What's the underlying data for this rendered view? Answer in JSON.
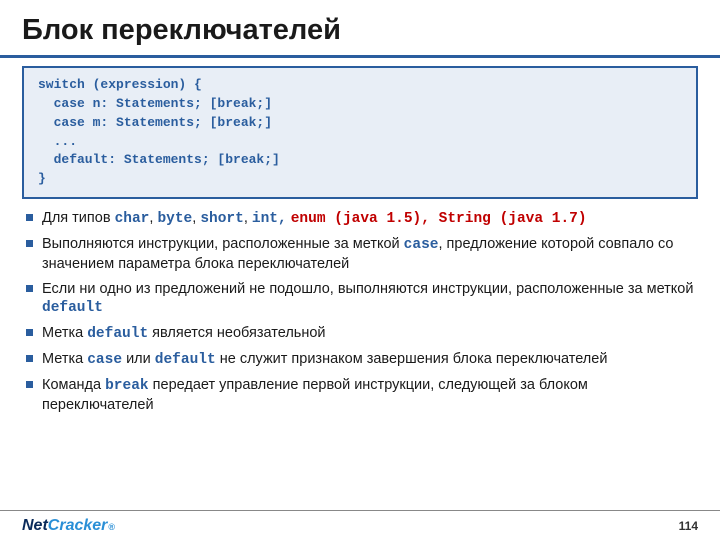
{
  "title": "Блок переключателей",
  "code": "switch (expression) {\n  case n: Statements; [break;]\n  case m: Statements; [break;]\n  ...\n  default: Statements; [break;]\n}",
  "b1": {
    "pre": "Для типов ",
    "types": "char",
    "c1": ", ",
    "t2": "byte",
    "c2": ", ",
    "t3": "short",
    "c3": ", ",
    "t4": "int,",
    "sp": " ",
    "enum": "enum (java 1.5), String (java 1.7)"
  },
  "b2": {
    "pre": "Выполняются инструкции, расположенные за меткой ",
    "kw": "case",
    "post": ", предложение которой совпало со значением параметра блока переключателей"
  },
  "b3": {
    "pre": "Если ни одно из предложений не подошло, выполняются инструкции, расположенные за меткой ",
    "kw": "default"
  },
  "b4": {
    "pre": "Метка ",
    "kw": "default",
    "post": " является необязательной"
  },
  "b5": {
    "pre": "Метка ",
    "kw1": "case",
    "mid": " или ",
    "kw2": "default",
    "post": " не служит признаком завершения блока переключателей"
  },
  "b6": {
    "pre": "Команда ",
    "kw": "break",
    "post": " передает управление первой инструкции, следующей за блоком переключателей"
  },
  "logo": {
    "a": "Net",
    "b": "Cracker",
    "reg": "®"
  },
  "page": "114"
}
